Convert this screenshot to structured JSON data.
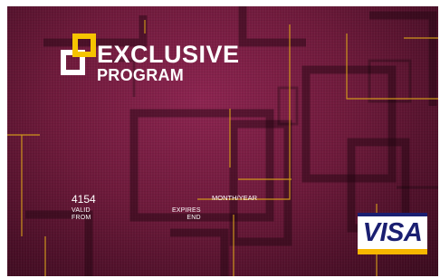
{
  "logo": {
    "line1": "EXCLUSIVE",
    "line2": "PROGRAM",
    "mark_icon": "interlocked-squares-logo-icon",
    "mark_colors": [
      "#f5c400",
      "#ffffff"
    ]
  },
  "card": {
    "number_fragment": "4154",
    "valid_from_label": [
      "VALID",
      "FROM"
    ],
    "expires_end_label": [
      "EXPIRES",
      "END"
    ],
    "month_year_label": "MONTH/YEAR",
    "background_color": "#6e1a3b",
    "accent_line_color": "#d9a21a"
  },
  "network": {
    "brand": "VISA",
    "brand_color": "#1a1f71",
    "band_color": "#f7b600"
  }
}
